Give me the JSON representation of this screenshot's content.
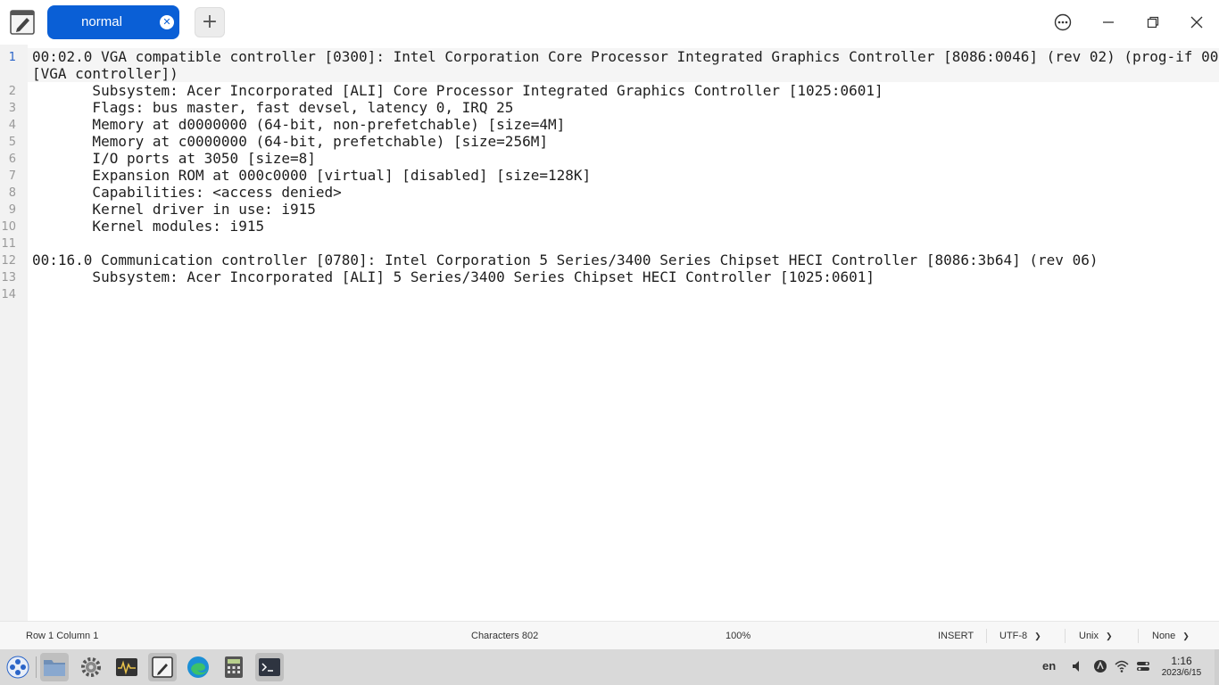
{
  "tab": {
    "label": "normal"
  },
  "editor": {
    "lines": [
      {
        "no": "1",
        "text": "00:02.0 VGA compatible controller [0300]: Intel Corporation Core Processor Integrated Graphics Controller [8086:0046] (rev 02) (prog-if 00"
      },
      {
        "no": "",
        "text": "[VGA controller])"
      },
      {
        "no": "2",
        "text": "       Subsystem: Acer Incorporated [ALI] Core Processor Integrated Graphics Controller [1025:0601]"
      },
      {
        "no": "3",
        "text": "       Flags: bus master, fast devsel, latency 0, IRQ 25"
      },
      {
        "no": "4",
        "text": "       Memory at d0000000 (64-bit, non-prefetchable) [size=4M]"
      },
      {
        "no": "5",
        "text": "       Memory at c0000000 (64-bit, prefetchable) [size=256M]"
      },
      {
        "no": "6",
        "text": "       I/O ports at 3050 [size=8]"
      },
      {
        "no": "7",
        "text": "       Expansion ROM at 000c0000 [virtual] [disabled] [size=128K]"
      },
      {
        "no": "8",
        "text": "       Capabilities: <access denied>"
      },
      {
        "no": "9",
        "text": "       Kernel driver in use: i915"
      },
      {
        "no": "10",
        "text": "       Kernel modules: i915"
      },
      {
        "no": "11",
        "text": ""
      },
      {
        "no": "12",
        "text": "00:16.0 Communication controller [0780]: Intel Corporation 5 Series/3400 Series Chipset HECI Controller [8086:3b64] (rev 06)"
      },
      {
        "no": "13",
        "text": "       Subsystem: Acer Incorporated [ALI] 5 Series/3400 Series Chipset HECI Controller [1025:0601]"
      },
      {
        "no": "14",
        "text": ""
      }
    ]
  },
  "status": {
    "position": "Row 1  Column 1",
    "characters": "Characters 802",
    "zoom": "100%",
    "mode": "INSERT",
    "encoding": "UTF-8",
    "line_ending": "Unix",
    "highlight": "None"
  },
  "taskbar": {
    "keyboard_layout": "en",
    "time": "1:16",
    "date": "2023/6/15"
  },
  "colors": {
    "accent": "#0a5fd6",
    "line_number_active": "#2a64c8"
  }
}
